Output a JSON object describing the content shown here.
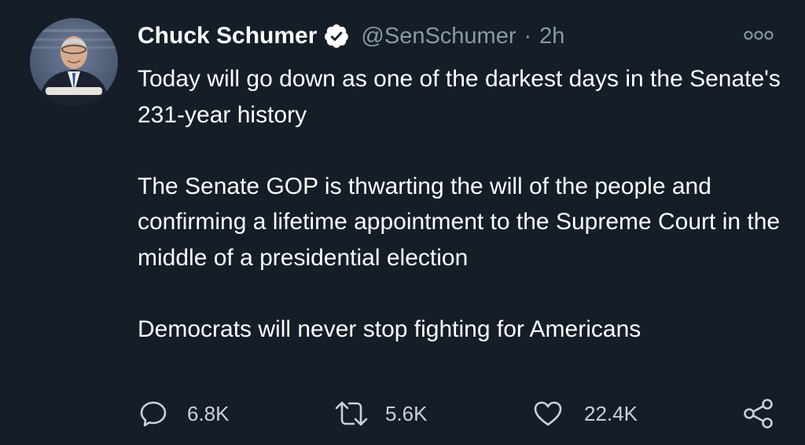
{
  "author": {
    "name": "Chuck Schumer",
    "handle": "@SenSchumer",
    "separator": "·",
    "time": "2h",
    "verified": true
  },
  "tweet": {
    "paragraphs": [
      "Today will go down as one of the darkest days in the Senate's 231-year history",
      "The Senate GOP is thwarting the will of the people and confirming a lifetime appointment to the Supreme Court in the middle of a presidential election",
      "Democrats will never stop fighting for Americans"
    ]
  },
  "stats": {
    "replies": "6.8K",
    "retweets": "5.6K",
    "likes": "22.4K"
  },
  "icons": {
    "more": "more-options-icon",
    "reply": "reply-icon",
    "retweet": "retweet-icon",
    "like": "heart-icon",
    "share": "share-icon",
    "verified": "verified-badge-icon"
  },
  "colors": {
    "background": "#151d27",
    "text": "#ffffff",
    "muted": "#8b98a5",
    "icon": "#c9d1d9"
  }
}
